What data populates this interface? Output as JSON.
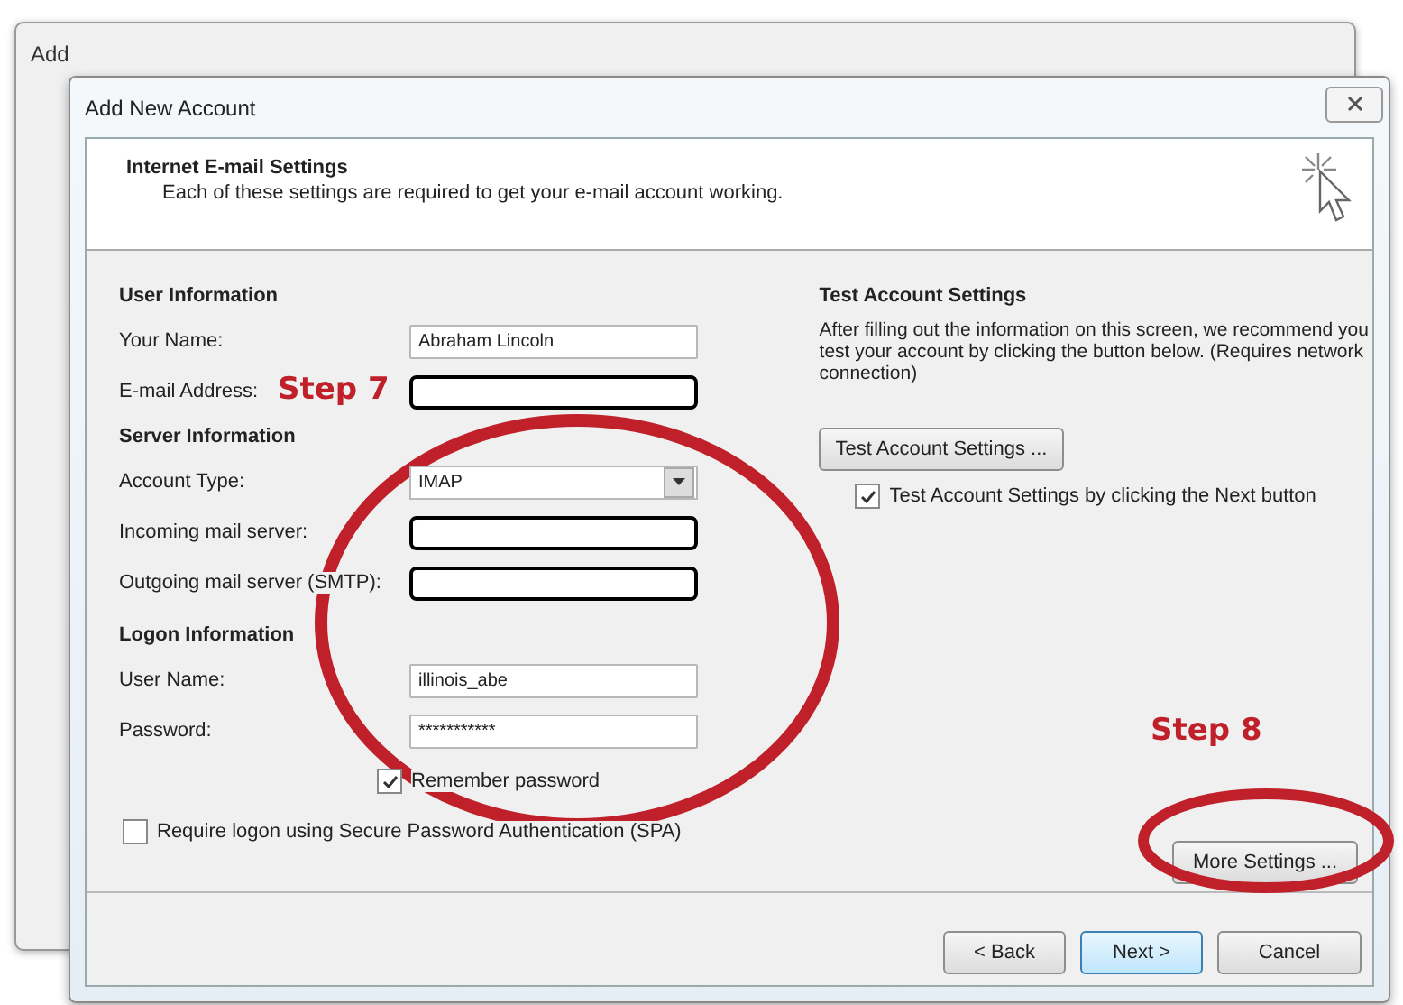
{
  "background_window": {
    "title": "Add"
  },
  "dialog": {
    "title": "Add New Account",
    "header": {
      "title": "Internet E-mail Settings",
      "subtitle": "Each of these settings are required to get your e-mail account working."
    },
    "sections": [
      {
        "heading": "User Information",
        "fields": [
          {
            "label": "Your Name:",
            "kind": "text",
            "value": "Abraham Lincoln"
          },
          {
            "label": "E-mail Address:",
            "kind": "redacted"
          }
        ]
      },
      {
        "heading": "Server Information",
        "fields": [
          {
            "label": "Account Type:",
            "kind": "dropdown",
            "value": "IMAP"
          },
          {
            "label": "Incoming mail server:",
            "kind": "redacted"
          },
          {
            "label": "Outgoing mail server (SMTP):",
            "kind": "redacted"
          }
        ]
      },
      {
        "heading": "Logon Information",
        "fields": [
          {
            "label": "User Name:",
            "kind": "text",
            "value": "illinois_abe"
          },
          {
            "label": "Password:",
            "kind": "text",
            "value": "***********"
          }
        ]
      }
    ],
    "remember_password": {
      "label": "Remember password",
      "checked": true
    },
    "spa": {
      "label": "Require logon using Secure Password Authentication (SPA)",
      "checked": false
    },
    "test": {
      "heading": "Test Account Settings",
      "text": "After filling out the information on this screen, we recommend you test your account by clicking the button below. (Requires network connection)",
      "button": "Test Account Settings ...",
      "checkbox": {
        "label": "Test Account Settings by clicking the Next button",
        "checked": true
      }
    },
    "more_settings": "More Settings ...",
    "footer_buttons": [
      {
        "label": "< Back",
        "focused": false
      },
      {
        "label": "Next >",
        "focused": true
      },
      {
        "label": "Cancel",
        "focused": false
      }
    ]
  },
  "annotations": [
    {
      "label": "Step 7"
    },
    {
      "label": "Step 8"
    }
  ]
}
